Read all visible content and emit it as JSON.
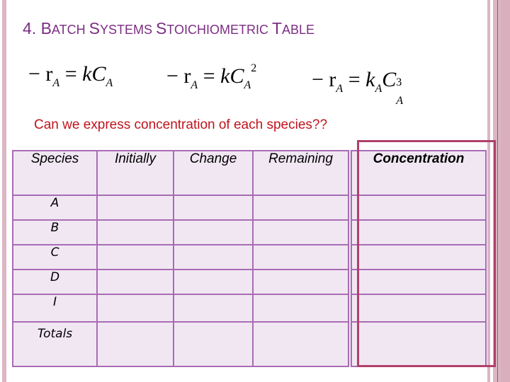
{
  "slide": {
    "title_parts": [
      {
        "cap": "4. B",
        "sc": "ATCH "
      },
      {
        "cap": "S",
        "sc": "YSTEMS "
      },
      {
        "cap": "S",
        "sc": "TOICHIOMETRIC "
      },
      {
        "cap": "T",
        "sc": "ABLE"
      }
    ],
    "title_full": "4. Batch Systems Stoichiometric Table",
    "equations": {
      "first_order": {
        "lhs": "− r",
        "lhs_sub": "A",
        "eq": " = ",
        "k": "k",
        "k_sub": "",
        "c": "C",
        "c_sub": "A",
        "power": ""
      },
      "second_order": {
        "lhs": "− r",
        "lhs_sub": "A",
        "eq": " = ",
        "k": "k",
        "k_sub": "",
        "c": "C",
        "c_sub": "A",
        "power": "2"
      },
      "third_order": {
        "lhs": "− r",
        "lhs_sub": "A",
        "eq": " = ",
        "k": "k",
        "k_sub": "A",
        "c": "C",
        "c_sub": "A",
        "power": "3"
      }
    },
    "question": "Can we express concentration of each species??",
    "colors": {
      "title": "#7b2d83",
      "question": "#c0141c",
      "table_border": "#a86cb4",
      "table_fill": "#f1e7f3",
      "highlight": "#b0406a",
      "stripes": "#dbb6c4"
    },
    "table": {
      "headers": [
        "Species",
        "Initially",
        "Change",
        "Remaining",
        "Concentration"
      ],
      "rows": [
        {
          "species": "A",
          "initially": "",
          "change": "",
          "remaining": "",
          "concentration": ""
        },
        {
          "species": "B",
          "initially": "",
          "change": "",
          "remaining": "",
          "concentration": ""
        },
        {
          "species": "C",
          "initially": "",
          "change": "",
          "remaining": "",
          "concentration": ""
        },
        {
          "species": "D",
          "initially": "",
          "change": "",
          "remaining": "",
          "concentration": ""
        },
        {
          "species": "I",
          "initially": "",
          "change": "",
          "remaining": "",
          "concentration": ""
        },
        {
          "species": "Totals",
          "initially": "",
          "change": "",
          "remaining": "",
          "concentration": ""
        }
      ],
      "highlighted_column": "Concentration"
    }
  }
}
